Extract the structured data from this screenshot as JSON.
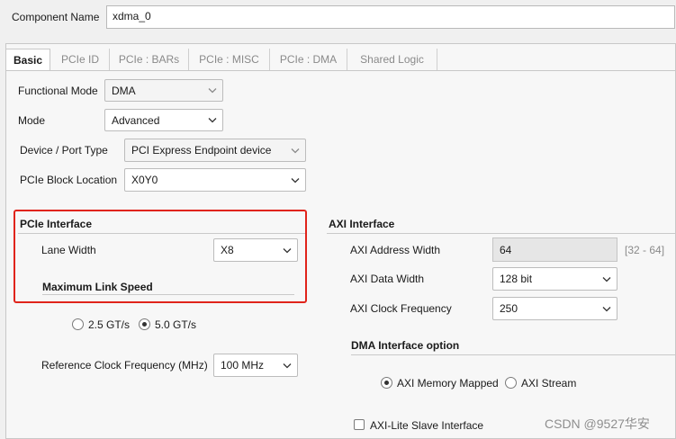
{
  "component": {
    "label": "Component Name",
    "value": "xdma_0"
  },
  "tabs": [
    {
      "label": "Basic",
      "active": true
    },
    {
      "label": "PCIe ID"
    },
    {
      "label": "PCIe : BARs"
    },
    {
      "label": "PCIe : MISC"
    },
    {
      "label": "PCIe : DMA"
    },
    {
      "label": "Shared Logic"
    }
  ],
  "basic": {
    "functional_mode": {
      "label": "Functional Mode",
      "value": "DMA"
    },
    "mode": {
      "label": "Mode",
      "value": "Advanced"
    },
    "device_port_type": {
      "label": "Device / Port Type",
      "value": "PCI Express Endpoint device"
    },
    "block_location": {
      "label": "PCIe Block Location",
      "value": "X0Y0"
    }
  },
  "pcie_interface": {
    "title": "PCIe Interface",
    "lane_width": {
      "label": "Lane Width",
      "value": "X8"
    },
    "max_link_speed": {
      "title": "Maximum Link Speed",
      "options": [
        {
          "label": "2.5 GT/s",
          "selected": false
        },
        {
          "label": "5.0 GT/s",
          "selected": true
        }
      ]
    },
    "ref_clock": {
      "label": "Reference Clock Frequency (MHz)",
      "value": "100 MHz"
    }
  },
  "axi_interface": {
    "title": "AXI Interface",
    "address_width": {
      "label": "AXI Address Width",
      "value": "64",
      "range": "[32 - 64]"
    },
    "data_width": {
      "label": "AXI Data Width",
      "value": "128 bit"
    },
    "clock_freq": {
      "label": "AXI Clock Frequency",
      "value": "250"
    }
  },
  "dma_interface": {
    "title": "DMA Interface option",
    "options": [
      {
        "label": "AXI Memory Mapped",
        "selected": true
      },
      {
        "label": "AXI Stream",
        "selected": false
      }
    ],
    "axi_lite_slave": {
      "label": "AXI-Lite Slave Interface",
      "checked": false
    }
  },
  "watermark": "CSDN @9527华安",
  "colors": {
    "highlight_border": "#e0241b"
  },
  "icons": {
    "dropdown": "chevron-down-icon"
  }
}
